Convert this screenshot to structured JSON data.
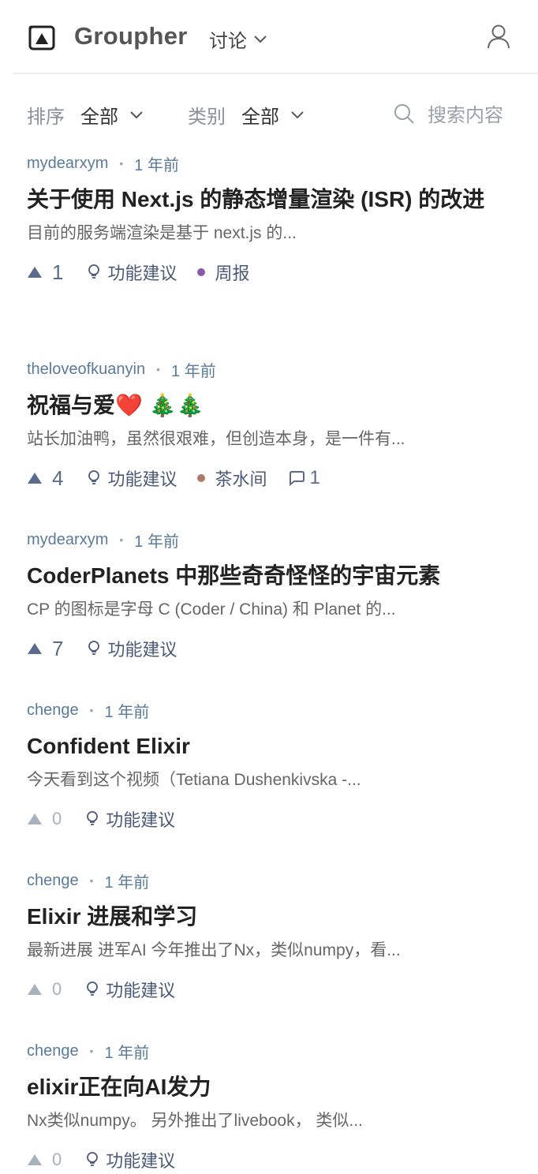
{
  "header": {
    "brand": "Groupher",
    "section": "讨论"
  },
  "filters": {
    "sort_label": "排序",
    "sort_value": "全部",
    "category_label": "类别",
    "category_value": "全部",
    "search_placeholder": "搜索内容"
  },
  "colors": {
    "accent": "#5a6b8c",
    "tag_weekly": "#8a5aa6",
    "tag_teahouse": "#b07a6a"
  },
  "posts": [
    {
      "author": "mydearxym",
      "time": "1 年前",
      "title": "关于使用 Next.js 的静态增量渲染 (ISR) 的改进",
      "digest": "目前的服务端渲染是基于 next.js 的...",
      "upvotes": "1",
      "tags": [
        "功能建议",
        "周报"
      ]
    },
    {
      "author": "theloveofkuanyin",
      "time": "1 年前",
      "title": "祝福与爱❤️ 🎄🎄",
      "digest": "站长加油鸭，虽然很艰难，但创造本身，是一件有...",
      "upvotes": "4",
      "tags": [
        "功能建议",
        "茶水间"
      ],
      "comments": "1"
    },
    {
      "author": "mydearxym",
      "time": "1 年前",
      "title": "CoderPlanets 中那些奇奇怪怪的宇宙元素",
      "digest": "CP 的图标是字母 C (Coder / China) 和 Planet 的...",
      "upvotes": "7",
      "tags": [
        "功能建议"
      ]
    },
    {
      "author": "chenge",
      "time": "1 年前",
      "title": "Confident Elixir",
      "digest": "今天看到这个视频（Tetiana Dushenkivska -...",
      "upvotes": "0",
      "tags": [
        "功能建议"
      ]
    },
    {
      "author": "chenge",
      "time": "1 年前",
      "title": "Elixir 进展和学习",
      "digest": "最新进展 进军AI 今年推出了Nx，类似numpy，看...",
      "upvotes": "0",
      "tags": [
        "功能建议"
      ]
    },
    {
      "author": "chenge",
      "time": "1 年前",
      "title": "elixir正在向AI发力",
      "digest": "Nx类似numpy。 另外推出了livebook， 类似...",
      "upvotes": "0",
      "tags": [
        "功能建议"
      ]
    }
  ]
}
